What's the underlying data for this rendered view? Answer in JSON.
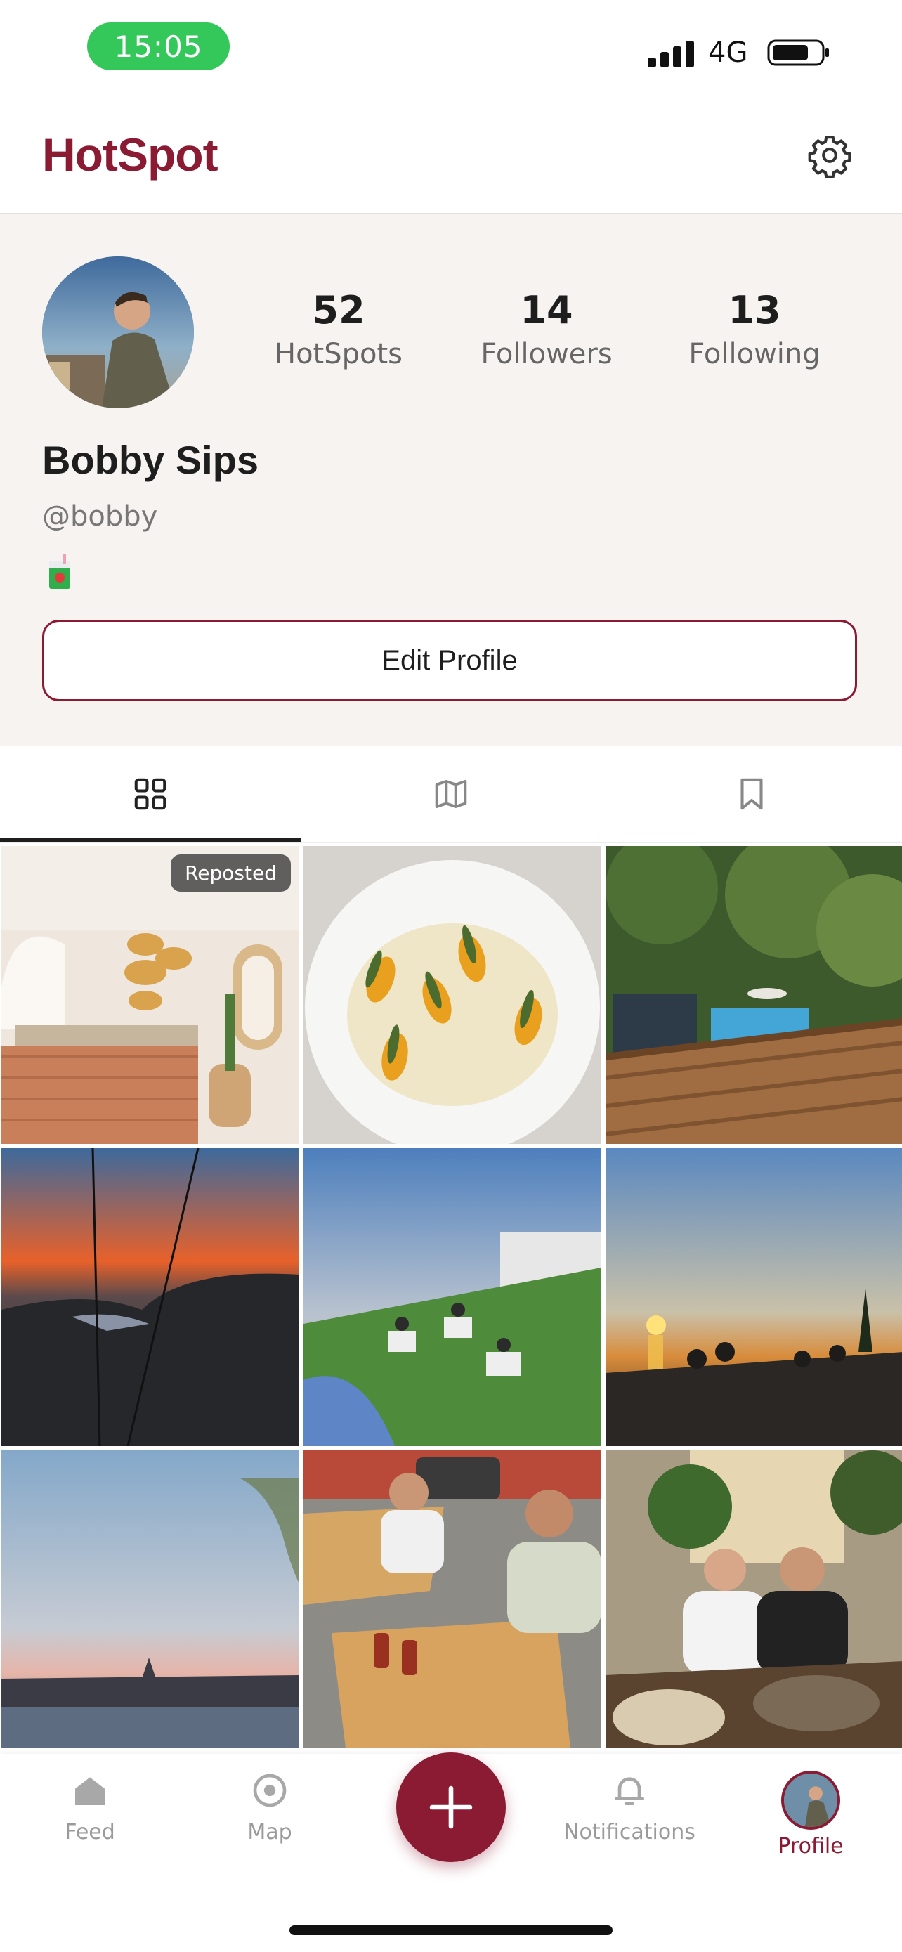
{
  "status_bar": {
    "time": "15:05",
    "network": "4G"
  },
  "header": {
    "title": "HotSpot"
  },
  "profile": {
    "name": "Bobby Sips",
    "handle": "@bobby",
    "stats": [
      {
        "value": "52",
        "label": "HotSpots"
      },
      {
        "value": "14",
        "label": "Followers"
      },
      {
        "value": "13",
        "label": "Following"
      }
    ],
    "edit_button": "Edit Profile"
  },
  "tabs": [
    {
      "icon": "grid-icon",
      "active": true
    },
    {
      "icon": "map-icon",
      "active": false
    },
    {
      "icon": "bookmark-icon",
      "active": false
    }
  ],
  "grid": {
    "reposted_label": "Reposted",
    "photos": [
      "bakery-interior-photo",
      "plated-dish-photo",
      "pool-terrace-photo",
      "cable-car-sunset-photo",
      "picnic-lawn-photo",
      "sea-sunset-photo",
      "river-city-dusk-photo",
      "street-table-friends-photo",
      "plaza-dinner-photo"
    ]
  },
  "nav": {
    "items": [
      {
        "label": "Feed",
        "icon": "home-icon"
      },
      {
        "label": "Map",
        "icon": "map-pin-icon"
      },
      {
        "label": "Notifications",
        "icon": "bell-icon"
      },
      {
        "label": "Profile",
        "icon": "avatar"
      }
    ],
    "add_icon": "plus-icon"
  },
  "colors": {
    "brand": "#8b1a33",
    "status_green": "#34c759",
    "panel_bg": "#f6f3f1"
  }
}
